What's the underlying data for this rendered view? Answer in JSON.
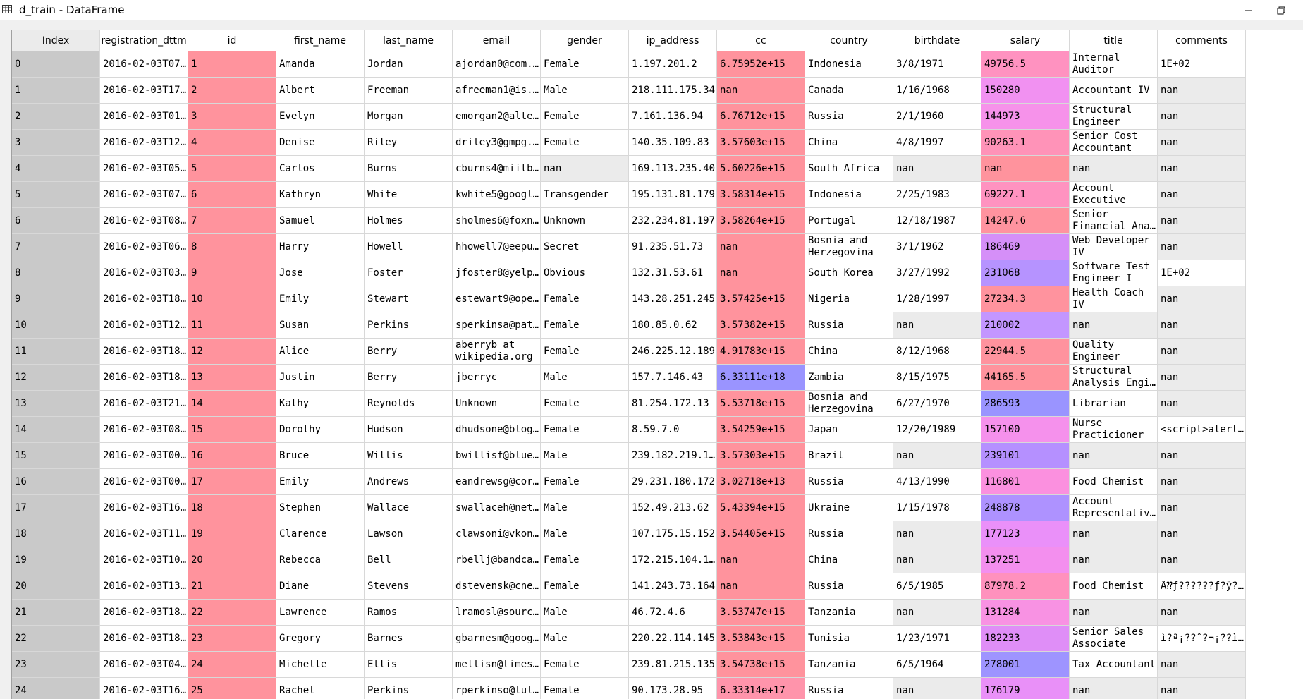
{
  "window": {
    "title": "d_train - DataFrame"
  },
  "colors": {
    "idx_bg": "#c9c9c9",
    "nan_bg": "#ebebeb",
    "id_bg": "#ff939d",
    "cc_default": "#ff939d",
    "cc_high": "#9a94ff"
  },
  "columns": [
    "Index",
    "registration_dttm",
    "id",
    "first_name",
    "last_name",
    "email",
    "gender",
    "ip_address",
    "cc",
    "country",
    "birthdate",
    "salary",
    "title",
    "comments"
  ],
  "rows": [
    [
      "0",
      "2016-02-03T07…",
      "1",
      "Amanda",
      "Jordan",
      "ajordan0@com.…",
      "Female",
      "1.197.201.2",
      "6.75952e+15",
      "Indonesia",
      "3/8/1971",
      "49756.5",
      "Internal Auditor",
      "1E+02"
    ],
    [
      "1",
      "2016-02-03T17…",
      "2",
      "Albert",
      "Freeman",
      "afreeman1@is.…",
      "Male",
      "218.111.175.34",
      "nan",
      "Canada",
      "1/16/1968",
      "150280",
      "Accountant IV",
      "nan"
    ],
    [
      "2",
      "2016-02-03T01…",
      "3",
      "Evelyn",
      "Morgan",
      "emorgan2@alte…",
      "Female",
      "7.161.136.94",
      "6.76712e+15",
      "Russia",
      "2/1/1960",
      "144973",
      "Structural Engineer",
      "nan"
    ],
    [
      "3",
      "2016-02-03T12…",
      "4",
      "Denise",
      "Riley",
      "driley3@gmpg.…",
      "Female",
      "140.35.109.83",
      "3.57603e+15",
      "China",
      "4/8/1997",
      "90263.1",
      "Senior Cost Accountant",
      "nan"
    ],
    [
      "4",
      "2016-02-03T05…",
      "5",
      "Carlos",
      "Burns",
      "cburns4@miitb…",
      "nan",
      "169.113.235.40",
      "5.60226e+15",
      "South Africa",
      "nan",
      "nan",
      "nan",
      "nan"
    ],
    [
      "5",
      "2016-02-03T07…",
      "6",
      "Kathryn",
      "White",
      "kwhite5@googl…",
      "Transgender",
      "195.131.81.179",
      "3.58314e+15",
      "Indonesia",
      "2/25/1983",
      "69227.1",
      "Account Executive",
      "nan"
    ],
    [
      "6",
      "2016-02-03T08…",
      "7",
      "Samuel",
      "Holmes",
      "sholmes6@foxn…",
      "Unknown",
      "232.234.81.197",
      "3.58264e+15",
      "Portugal",
      "12/18/1987",
      "14247.6",
      "Senior Financial Ana…",
      "nan"
    ],
    [
      "7",
      "2016-02-03T06…",
      "8",
      "Harry",
      "Howell",
      "hhowell7@eepu…",
      "Secret",
      "91.235.51.73",
      "nan",
      "Bosnia and Herzegovina",
      "3/1/1962",
      "186469",
      "Web Developer IV",
      "nan"
    ],
    [
      "8",
      "2016-02-03T03…",
      "9",
      "Jose",
      "Foster",
      "jfoster8@yelp…",
      "Obvious",
      "132.31.53.61",
      "nan",
      "South Korea",
      "3/27/1992",
      "231068",
      "Software Test Engineer I",
      "1E+02"
    ],
    [
      "9",
      "2016-02-03T18…",
      "10",
      "Emily",
      "Stewart",
      "estewart9@ope…",
      "Female",
      "143.28.251.245",
      "3.57425e+15",
      "Nigeria",
      "1/28/1997",
      "27234.3",
      "Health Coach IV",
      "nan"
    ],
    [
      "10",
      "2016-02-03T12…",
      "11",
      "Susan",
      "Perkins",
      "sperkinsa@pat…",
      "Female",
      "180.85.0.62",
      "3.57382e+15",
      "Russia",
      "nan",
      "210002",
      "nan",
      "nan"
    ],
    [
      "11",
      "2016-02-03T18…",
      "12",
      "Alice",
      "Berry",
      "aberryb at wikipedia.org",
      "Female",
      "246.225.12.189",
      "4.91783e+15",
      "China",
      "8/12/1968",
      "22944.5",
      "Quality Engineer",
      "nan"
    ],
    [
      "12",
      "2016-02-03T18…",
      "13",
      "Justin",
      "Berry",
      "jberryc",
      "Male",
      "157.7.146.43",
      "6.33111e+18",
      "Zambia",
      "8/15/1975",
      "44165.5",
      "Structural Analysis Engi…",
      "nan"
    ],
    [
      "13",
      "2016-02-03T21…",
      "14",
      "Kathy",
      "Reynolds",
      "Unknown",
      "Female",
      "81.254.172.13",
      "5.53718e+15",
      "Bosnia and Herzegovina",
      "6/27/1970",
      "286593",
      "Librarian",
      "nan"
    ],
    [
      "14",
      "2016-02-03T08…",
      "15",
      "Dorothy",
      "Hudson",
      "dhudsone@blog…",
      "Female",
      "8.59.7.0",
      "3.54259e+15",
      "Japan",
      "12/20/1989",
      "157100",
      "Nurse Practicioner",
      "<script>alert…"
    ],
    [
      "15",
      "2016-02-03T00…",
      "16",
      "Bruce",
      "Willis",
      "bwillisf@blue…",
      "Male",
      "239.182.219.1…",
      "3.57303e+15",
      "Brazil",
      "nan",
      "239101",
      "nan",
      "nan"
    ],
    [
      "16",
      "2016-02-03T00…",
      "17",
      "Emily",
      "Andrews",
      "eandrewsg@cor…",
      "Female",
      "29.231.180.172",
      "3.02718e+13",
      "Russia",
      "4/13/1990",
      "116801",
      "Food Chemist",
      "nan"
    ],
    [
      "17",
      "2016-02-03T16…",
      "18",
      "Stephen",
      "Wallace",
      "swallaceh@net…",
      "Male",
      "152.49.213.62",
      "5.43394e+15",
      "Ukraine",
      "1/15/1978",
      "248878",
      "Account Representativ…",
      "nan"
    ],
    [
      "18",
      "2016-02-03T11…",
      "19",
      "Clarence",
      "Lawson",
      "clawsoni@vkon…",
      "Male",
      "107.175.15.152",
      "3.54405e+15",
      "Russia",
      "nan",
      "177123",
      "nan",
      "nan"
    ],
    [
      "19",
      "2016-02-03T10…",
      "20",
      "Rebecca",
      "Bell",
      "rbellj@bandca…",
      "Female",
      "172.215.104.1…",
      "nan",
      "China",
      "nan",
      "137251",
      "nan",
      "nan"
    ],
    [
      "20",
      "2016-02-03T13…",
      "21",
      "Diane",
      "Stevens",
      "dstevensk@cne…",
      "Female",
      "141.243.73.164",
      "nan",
      "Russia",
      "6/5/1985",
      "87978.2",
      "Food Chemist",
      "Å⁇ƒ??????ƒ?ÿ?…"
    ],
    [
      "21",
      "2016-02-03T18…",
      "22",
      "Lawrence",
      "Ramos",
      "lramosl@sourc…",
      "Male",
      "46.72.4.6",
      "3.53747e+15",
      "Tanzania",
      "nan",
      "131284",
      "nan",
      "nan"
    ],
    [
      "22",
      "2016-02-03T18…",
      "23",
      "Gregory",
      "Barnes",
      "gbarnesm@goog…",
      "Male",
      "220.22.114.145",
      "3.53843e+15",
      "Tunisia",
      "1/23/1971",
      "182233",
      "Senior Sales Associate",
      "ì?ª¡??ˆ?¬¡??ì…"
    ],
    [
      "23",
      "2016-02-03T04…",
      "24",
      "Michelle",
      "Ellis",
      "mellisn@times…",
      "Female",
      "239.81.215.135",
      "3.54738e+15",
      "Tanzania",
      "6/5/1964",
      "278001",
      "Tax Accountant",
      "nan"
    ],
    [
      "24",
      "2016-02-03T16…",
      "25",
      "Rachel",
      "Perkins",
      "rperkinso@lul…",
      "Female",
      "90.173.28.95",
      "6.33314e+17",
      "Russia",
      "nan",
      "176179",
      "nan",
      "nan"
    ]
  ],
  "salary_colors": [
    "#ff92c0",
    "#f191f1",
    "#f692ea",
    "#ff93b8",
    "#ff939d",
    "#ff93c0",
    "#ff939f",
    "#d58ff8",
    "#b693ff",
    "#ff939e",
    "#c396ff",
    "#ff939e",
    "#ff939d",
    "#9a94ff",
    "#f591ec",
    "#b590ff",
    "#fb90df",
    "#ae92ff",
    "#ea90f9",
    "#f38fee",
    "#ff91bd",
    "#f892e3",
    "#df8ef7",
    "#9e94ff",
    "#e990f8"
  ],
  "cc_colors": [
    "#ff939d",
    "#ff939d",
    "#ff939d",
    "#ff939d",
    "#ff939d",
    "#ff939d",
    "#ff939d",
    "#ff939d",
    "#ff939d",
    "#ff939d",
    "#ff939d",
    "#ff939d",
    "#9a94ff",
    "#ff939d",
    "#ff939d",
    "#ff939d",
    "#ff939d",
    "#ff939d",
    "#ff939d",
    "#ff939d",
    "#ff939d",
    "#ff939d",
    "#ff939d",
    "#ff939d",
    "#ff94ab"
  ]
}
